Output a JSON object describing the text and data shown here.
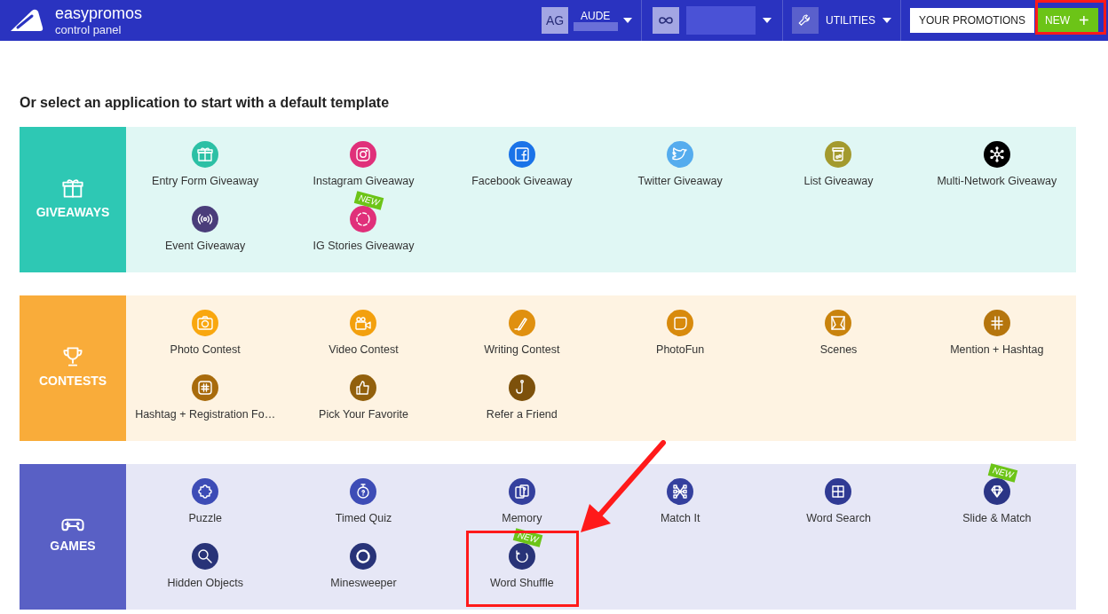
{
  "header": {
    "brand": "easypromos",
    "subtitle": "control panel",
    "account": {
      "initials": "AG",
      "name": "AUDE"
    },
    "utilities": "UTILITIES",
    "buttons": [
      {
        "label": "YOUR PROMOTIONS",
        "kind": "outline"
      },
      {
        "label": "NEW",
        "kind": "primary",
        "icon": "+"
      }
    ]
  },
  "heading": "Or select an application to start with a default template",
  "sections": [
    {
      "title": "GIVEAWAYS",
      "color": "#2ec8b4",
      "apps": [
        {
          "label": "Entry Form Giveaway",
          "color": "#2cc0a5",
          "new": false
        },
        {
          "label": "Instagram Giveaway",
          "color": "#e0307a",
          "new": false
        },
        {
          "label": "Facebook Giveaway",
          "color": "#1a73e8",
          "new": false
        },
        {
          "label": "Twitter Giveaway",
          "color": "#55acee",
          "new": false
        },
        {
          "label": "List Giveaway",
          "color": "#a39a2e",
          "new": false
        },
        {
          "label": "Multi-Network Giveaway",
          "color": "#000000",
          "new": false
        },
        {
          "label": "Event Giveaway",
          "color": "#4a3d7a",
          "new": false
        },
        {
          "label": "IG Stories Giveaway",
          "color": "#e0307a",
          "new": true,
          "badge": "NEW"
        }
      ]
    },
    {
      "title": "CONTESTS",
      "color": "#f9ac3a",
      "apps": [
        {
          "label": "Photo Contest",
          "color": "#f9a70f",
          "new": false
        },
        {
          "label": "Video Contest",
          "color": "#f3a00e",
          "new": false
        },
        {
          "label": "Writing Contest",
          "color": "#e0900f",
          "new": false
        },
        {
          "label": "PhotoFun",
          "color": "#d88a0c",
          "new": false
        },
        {
          "label": "Scenes",
          "color": "#c9830d",
          "new": false
        },
        {
          "label": "Mention + Hashtag",
          "color": "#b5750d",
          "new": false
        },
        {
          "label": "Hashtag + Registration Fo…",
          "color": "#a86b0c",
          "new": false
        },
        {
          "label": "Pick Your Favorite",
          "color": "#92600c",
          "new": false
        },
        {
          "label": "Refer a Friend",
          "color": "#7d510b",
          "new": false
        }
      ]
    },
    {
      "title": "GAMES",
      "color": "#5960c5",
      "apps": [
        {
          "label": "Puzzle",
          "color": "#3d4cb6",
          "new": false
        },
        {
          "label": "Timed Quiz",
          "color": "#3d4cb6",
          "new": false
        },
        {
          "label": "Memory",
          "color": "#34409e",
          "new": false
        },
        {
          "label": "Match It",
          "color": "#34409e",
          "new": false
        },
        {
          "label": "Word Search",
          "color": "#2f3a94",
          "new": false
        },
        {
          "label": "Slide & Match",
          "color": "#2b3586",
          "new": true,
          "badge": "NEW"
        },
        {
          "label": "Hidden Objects",
          "color": "#283378",
          "new": false
        },
        {
          "label": "Minesweeper",
          "color": "#283378",
          "new": false
        },
        {
          "label": "Word Shuffle",
          "color": "#283378",
          "new": true,
          "badge": "NEW"
        }
      ]
    }
  ]
}
